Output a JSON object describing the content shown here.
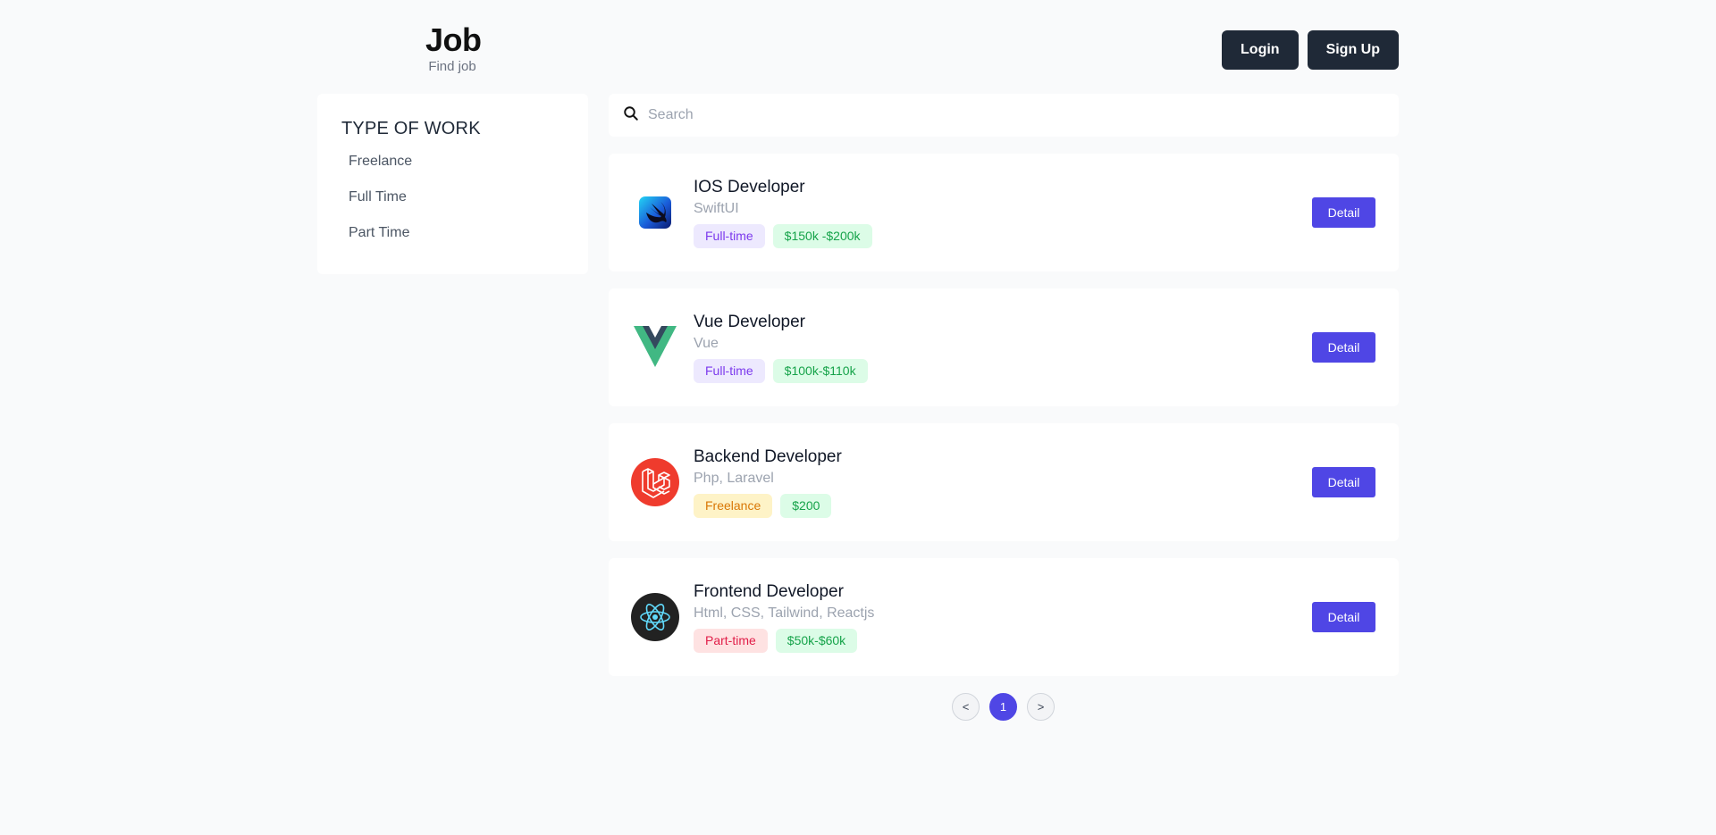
{
  "brand": {
    "title": "Job",
    "subtitle": "Find job"
  },
  "auth": {
    "login_label": "Login",
    "signup_label": "Sign Up"
  },
  "sidebar": {
    "title": "TYPE OF WORK",
    "items": [
      {
        "label": "Freelance"
      },
      {
        "label": "Full Time"
      },
      {
        "label": "Part Time"
      }
    ]
  },
  "search": {
    "placeholder": "Search",
    "value": ""
  },
  "jobs": [
    {
      "title": "IOS Developer",
      "tech": "SwiftUI",
      "type": "Full-time",
      "salary": "$150k -$200k",
      "logo": "swift-icon",
      "detail": "Detail"
    },
    {
      "title": "Vue Developer",
      "tech": "Vue",
      "type": "Full-time",
      "salary": "$100k-$110k",
      "logo": "vue-icon",
      "detail": "Detail"
    },
    {
      "title": "Backend Developer",
      "tech": "Php, Laravel",
      "type": "Freelance",
      "salary": "$200",
      "logo": "laravel-icon",
      "detail": "Detail"
    },
    {
      "title": "Frontend Developer",
      "tech": "Html, CSS, Tailwind, Reactjs",
      "type": "Part-time",
      "salary": "$50k-$60k",
      "logo": "react-icon",
      "detail": "Detail"
    }
  ],
  "pagination": {
    "prev": "<",
    "current": "1",
    "next": ">"
  },
  "colors": {
    "accent": "#4f46e5",
    "dark": "#1f2937",
    "background": "#f9fafb"
  }
}
